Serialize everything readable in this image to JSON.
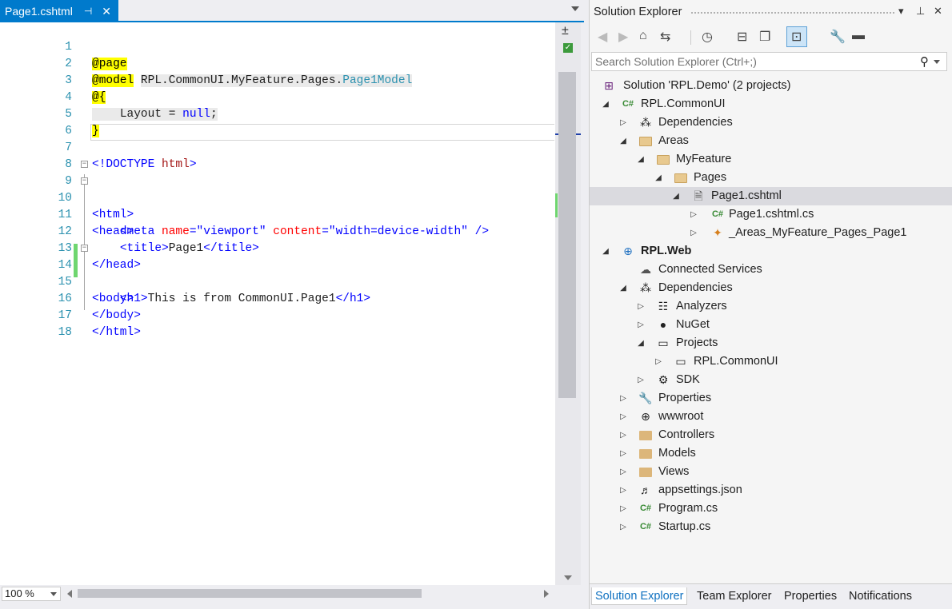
{
  "editor": {
    "tab_title": "Page1.cshtml",
    "pin_glyph": "⊣",
    "close_glyph": "✕",
    "zoom_value": "100 %",
    "lines": [
      {
        "n": "1"
      },
      {
        "n": "2"
      },
      {
        "n": "3"
      },
      {
        "n": "4"
      },
      {
        "n": "5"
      },
      {
        "n": "6"
      },
      {
        "n": "7"
      },
      {
        "n": "8"
      },
      {
        "n": "9"
      },
      {
        "n": "10"
      },
      {
        "n": "11"
      },
      {
        "n": "12"
      },
      {
        "n": "13"
      },
      {
        "n": "14"
      },
      {
        "n": "15"
      },
      {
        "n": "16"
      },
      {
        "n": "17"
      },
      {
        "n": "18"
      }
    ],
    "code": {
      "l1_directive": "@page",
      "l2_directive": "@model",
      "l2_ns": "RPL.CommonUI.MyFeature.Pages.",
      "l2_type": "Page1Model",
      "l3_open": "@{",
      "l4_a": "Layout = ",
      "l4_null": "null",
      "l4_semi": ";",
      "l5_close": "}",
      "l7_doctype": "<!DOCTYPE ",
      "l7_html": "html",
      "l7_end": ">",
      "l9": "<html>",
      "l10": "<head>",
      "l11_tag": "<meta ",
      "l11_name_attr": "name",
      "l11_eq1": "=",
      "l11_name_val": "\"viewport\"",
      "l11_content_attr": " content",
      "l11_eq2": "=",
      "l11_content_val": "\"width=device-width\"",
      "l11_end": " />",
      "l12_open": "<title>",
      "l12_text": "Page1",
      "l12_close": "</title>",
      "l13": "</head>",
      "l14": "<body>",
      "l15_open": "<h1>",
      "l15_text": "This is from CommonUI.Page1",
      "l15_close": "</h1>",
      "l16": "</body>",
      "l17": "</html>"
    }
  },
  "solution_explorer": {
    "title": "Solution Explorer",
    "search_placeholder": "Search Solution Explorer (Ctrl+;)",
    "tree": [
      {
        "label": "Solution 'RPL.Demo' (2 projects)",
        "icon": "solution-icon"
      },
      {
        "label": "RPL.CommonUI",
        "icon": "csharp-project-icon"
      },
      {
        "label": "Dependencies",
        "icon": "dependencies-icon"
      },
      {
        "label": "Areas",
        "icon": "folder-icon"
      },
      {
        "label": "MyFeature",
        "icon": "folder-icon"
      },
      {
        "label": "Pages",
        "icon": "folder-icon"
      },
      {
        "label": "Page1.cshtml",
        "icon": "razor-file-icon"
      },
      {
        "label": "Page1.cshtml.cs",
        "icon": "csharp-file-icon"
      },
      {
        "label": "_Areas_MyFeature_Pages_Page1",
        "icon": "class-icon"
      },
      {
        "label": "RPL.Web",
        "icon": "web-project-icon"
      },
      {
        "label": "Connected Services",
        "icon": "connected-services-icon"
      },
      {
        "label": "Dependencies",
        "icon": "dependencies-icon"
      },
      {
        "label": "Analyzers",
        "icon": "analyzers-icon"
      },
      {
        "label": "NuGet",
        "icon": "nuget-icon"
      },
      {
        "label": "Projects",
        "icon": "projects-icon"
      },
      {
        "label": "RPL.CommonUI",
        "icon": "project-ref-icon"
      },
      {
        "label": "SDK",
        "icon": "sdk-icon"
      },
      {
        "label": "Properties",
        "icon": "wrench-icon"
      },
      {
        "label": "wwwroot",
        "icon": "globe-icon"
      },
      {
        "label": "Controllers",
        "icon": "folder-icon"
      },
      {
        "label": "Models",
        "icon": "folder-icon"
      },
      {
        "label": "Views",
        "icon": "folder-icon"
      },
      {
        "label": "appsettings.json",
        "icon": "json-file-icon"
      },
      {
        "label": "Program.cs",
        "icon": "csharp-file-icon"
      },
      {
        "label": "Startup.cs",
        "icon": "csharp-file-icon"
      }
    ],
    "bottom_tabs": [
      "Solution Explorer",
      "Team Explorer",
      "Properties",
      "Notifications"
    ]
  },
  "colors": {
    "accent": "#007acc",
    "line_number": "#2b91af",
    "razor_highlight": "#ffff00",
    "html_tag": "#a31515",
    "attr_name": "#ff0000",
    "attr_value": "#0000ff",
    "change_marker": "#6fd66f"
  }
}
